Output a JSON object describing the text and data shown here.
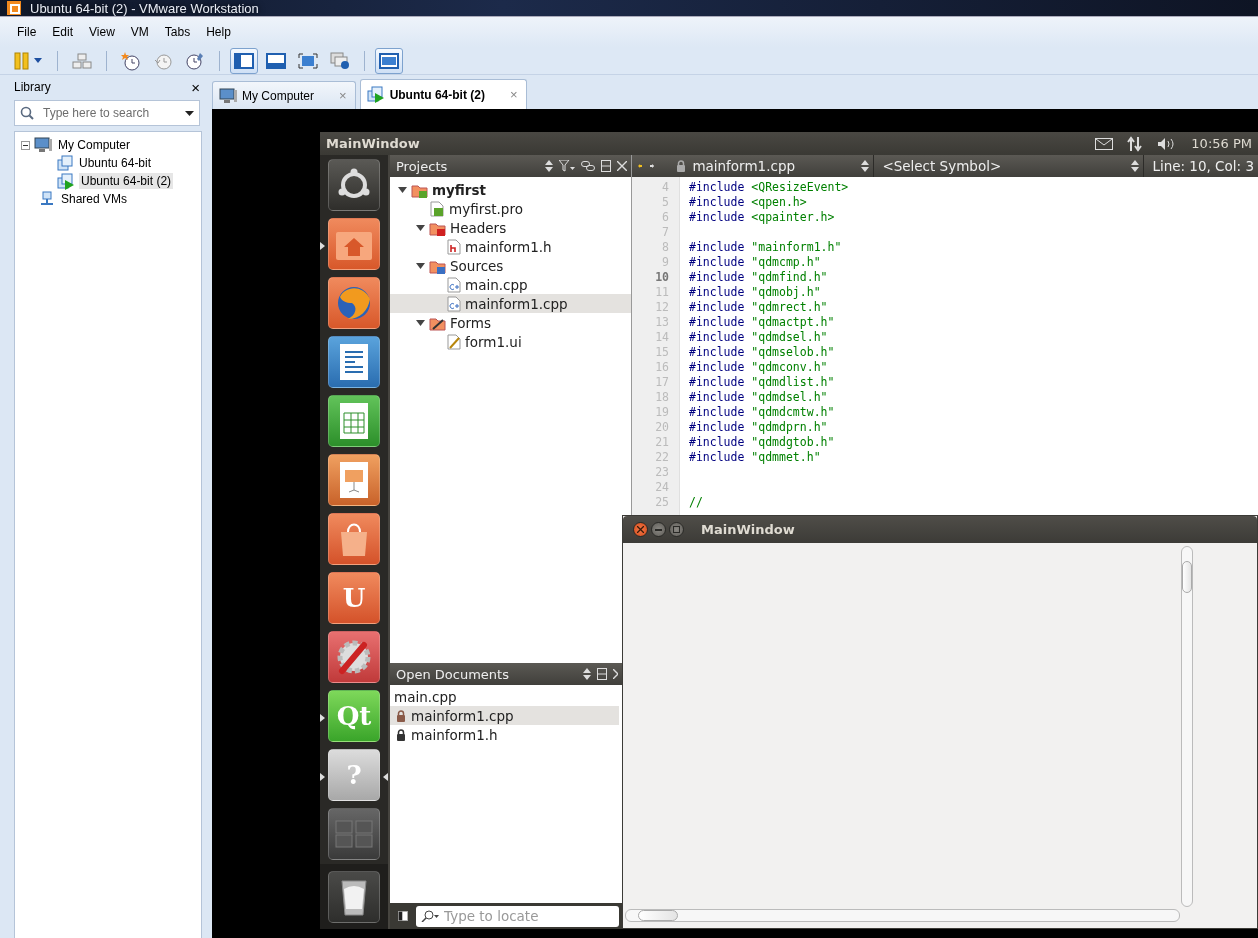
{
  "window": {
    "title": "Ubuntu 64-bit (2) - VMware Workstation"
  },
  "menu": [
    "File",
    "Edit",
    "View",
    "VM",
    "Tabs",
    "Help"
  ],
  "toolbar": [
    [
      {
        "kind": "pause",
        "selected": false
      }
    ],
    [
      {
        "kind": "keyboard",
        "selected": false
      }
    ],
    [
      {
        "kind": "snapshot",
        "selected": false
      },
      {
        "kind": "revert",
        "selected": false
      },
      {
        "kind": "manage",
        "selected": false
      }
    ],
    [
      {
        "kind": "console",
        "selected": true
      },
      {
        "kind": "quickswitch",
        "selected": false
      },
      {
        "kind": "fullscreen",
        "selected": false
      },
      {
        "kind": "unity",
        "selected": false
      }
    ],
    [
      {
        "kind": "thumbnails",
        "selected": true
      }
    ]
  ],
  "library": {
    "title": "Library",
    "close": "×",
    "search": {
      "placeholder": "Type here to search"
    },
    "tree": [
      {
        "label": "My Computer",
        "kind": "computer",
        "expanded": true,
        "selected": false,
        "children": [
          {
            "label": "Ubuntu 64-bit",
            "kind": "vm",
            "selected": false
          },
          {
            "label": "Ubuntu 64-bit (2)",
            "kind": "vm-running",
            "selected": true
          }
        ]
      },
      {
        "label": "Shared VMs",
        "kind": "shared",
        "selected": false
      }
    ]
  },
  "tabs": [
    {
      "label": "My Computer",
      "kind": "computer",
      "selected": false,
      "close": "×"
    },
    {
      "label": "Ubuntu 64-bit (2)",
      "kind": "vm-running",
      "selected": true,
      "close": "×"
    }
  ],
  "guest": {
    "panel": {
      "title": "MainWindow",
      "time": "10:56 PM"
    },
    "launcher": [
      {
        "kind": "dash",
        "running": false
      },
      {
        "kind": "home",
        "running": true
      },
      {
        "kind": "browser",
        "running": false
      },
      {
        "kind": "writer",
        "running": false
      },
      {
        "kind": "calc",
        "running": false
      },
      {
        "kind": "impress",
        "running": false
      },
      {
        "kind": "software",
        "running": false
      },
      {
        "kind": "one",
        "label": "U",
        "running": false
      },
      {
        "kind": "settings",
        "running": false
      },
      {
        "kind": "qt",
        "label": "Qt",
        "running": true
      },
      {
        "kind": "help",
        "label": "?",
        "running": true
      },
      {
        "kind": "workspaces",
        "running": false
      }
    ],
    "projects": {
      "title": "Projects",
      "tree": [
        {
          "label": "myfirst",
          "kind": "project",
          "expanded": true,
          "selected": false,
          "children": [
            {
              "label": "myfirst.pro",
              "kind": "pro",
              "selected": false
            },
            {
              "label": "Headers",
              "kind": "folder-h",
              "expanded": true,
              "selected": false,
              "children": [
                {
                  "label": "mainform1.h",
                  "kind": "header",
                  "selected": false
                }
              ]
            },
            {
              "label": "Sources",
              "kind": "folder-src",
              "expanded": true,
              "selected": false,
              "children": [
                {
                  "label": "main.cpp",
                  "kind": "cpp",
                  "selected": false
                },
                {
                  "label": "mainform1.cpp",
                  "kind": "cpp",
                  "selected": true
                }
              ]
            },
            {
              "label": "Forms",
              "kind": "folder-forms",
              "expanded": true,
              "selected": false,
              "children": [
                {
                  "label": "form1.ui",
                  "kind": "ui",
                  "selected": false
                }
              ]
            }
          ]
        }
      ]
    },
    "open_documents": {
      "title": "Open Documents",
      "items": [
        {
          "label": "main.cpp",
          "locked": false,
          "selected": false
        },
        {
          "label": "mainform1.cpp",
          "locked": true,
          "selected": true
        },
        {
          "label": "mainform1.h",
          "locked": true,
          "selected": false
        }
      ]
    },
    "locate": {
      "placeholder": "Type to locate"
    },
    "editor": {
      "file": "mainform1.cpp",
      "symbol": "<Select Symbol>",
      "position": "Line: 10, Col: 3",
      "lines": [
        {
          "number": "4",
          "kind": "include",
          "code": "#include",
          "arg": "<QResizeEvent>",
          "current": false
        },
        {
          "number": "5",
          "kind": "include",
          "code": "#include",
          "arg": "<qpen.h>",
          "current": false
        },
        {
          "number": "6",
          "kind": "include",
          "code": "#include",
          "arg": "<qpainter.h>",
          "current": false
        },
        {
          "number": "7",
          "kind": "blank",
          "current": false
        },
        {
          "number": "8",
          "kind": "include",
          "code": "#include",
          "arg": "\"mainform1.h\"",
          "current": false
        },
        {
          "number": "9",
          "kind": "include",
          "code": "#include",
          "arg": "\"qdmcmp.h\"",
          "current": false
        },
        {
          "number": "10",
          "kind": "include",
          "code": "#include",
          "arg": "\"qdmfind.h\"",
          "current": true
        },
        {
          "number": "11",
          "kind": "include",
          "code": "#include",
          "arg": "\"qdmobj.h\"",
          "current": false
        },
        {
          "number": "12",
          "kind": "include",
          "code": "#include",
          "arg": "\"qdmrect.h\"",
          "current": false
        },
        {
          "number": "13",
          "kind": "include",
          "code": "#include",
          "arg": "\"qdmactpt.h\"",
          "current": false
        },
        {
          "number": "14",
          "kind": "include",
          "code": "#include",
          "arg": "\"qdmdsel.h\"",
          "current": false
        },
        {
          "number": "15",
          "kind": "include",
          "code": "#include",
          "arg": "\"qdmselob.h\"",
          "current": false
        },
        {
          "number": "16",
          "kind": "include",
          "code": "#include",
          "arg": "\"qdmconv.h\"",
          "current": false
        },
        {
          "number": "17",
          "kind": "include",
          "code": "#include",
          "arg": "\"qdmdlist.h\"",
          "current": false
        },
        {
          "number": "18",
          "kind": "include",
          "code": "#include",
          "arg": "\"qdmdsel.h\"",
          "current": false
        },
        {
          "number": "19",
          "kind": "include",
          "code": "#include",
          "arg": "\"qdmdcmtw.h\"",
          "current": false
        },
        {
          "number": "20",
          "kind": "include",
          "code": "#include",
          "arg": "\"qdmdprn.h\"",
          "current": false
        },
        {
          "number": "21",
          "kind": "include",
          "code": "#include",
          "arg": "\"qdmdgtob.h\"",
          "current": false
        },
        {
          "number": "22",
          "kind": "include",
          "code": "#include",
          "arg": "\"qdmmet.h\"",
          "current": false
        },
        {
          "number": "23",
          "kind": "blank",
          "current": false
        },
        {
          "number": "24",
          "kind": "blank",
          "current": false
        },
        {
          "number": "25",
          "kind": "comment",
          "code": "//",
          "current": false
        }
      ]
    },
    "app_window": {
      "title": "MainWindow"
    }
  }
}
